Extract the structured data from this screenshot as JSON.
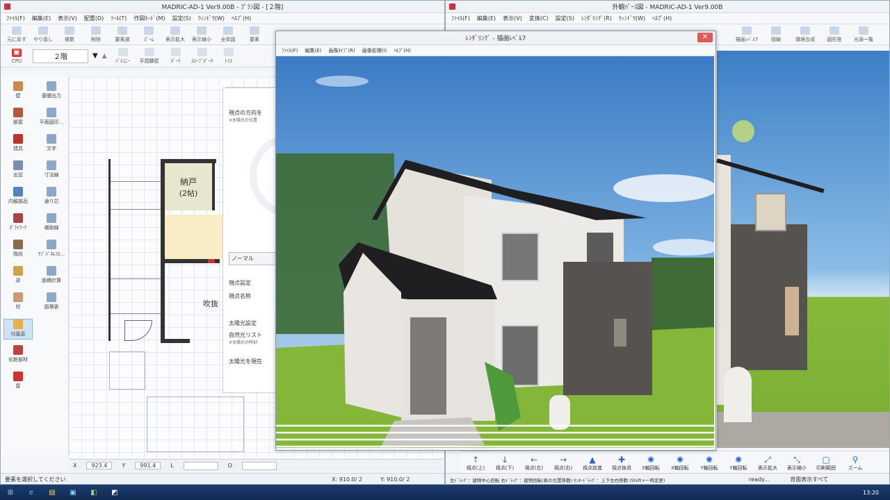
{
  "left_window": {
    "title": "MADRIC-AD-1 Ver9.00B - ﾌﾟﾗﾝ図 - [２階]",
    "menus": [
      "ﾌｧｲﾙ(F)",
      "編集(E)",
      "表示(V)",
      "配置(D)",
      "ﾂｰﾙ(T)",
      "作図ﾓｰﾄﾞ(M)",
      "設定(S)",
      "ｳｨﾝﾄﾞｳ(W)",
      "ﾍﾙﾌﾟ(H)"
    ],
    "toolbar": [
      {
        "label": "元に戻す",
        "icon": "undo-icon"
      },
      {
        "label": "やり直し",
        "icon": "redo-icon"
      },
      {
        "label": "複数",
        "icon": "copy-icon"
      },
      {
        "label": "削除",
        "icon": "delete-icon"
      },
      {
        "label": "要素選",
        "icon": "select-icon"
      },
      {
        "label": "ｽﾞｰﾑ",
        "icon": "zoom-icon"
      },
      {
        "label": "表示拡大",
        "icon": "zoom-in-icon"
      },
      {
        "label": "表示縮小",
        "icon": "zoom-out-icon"
      },
      {
        "label": "全体図",
        "icon": "fit-icon"
      },
      {
        "label": "要素",
        "icon": "pointer-icon"
      }
    ],
    "floor_label": "２階",
    "cpu_label": "CPU",
    "toolbar2": [
      "ﾊﾞﾙｺﾆｰ",
      "手摺腰壁",
      "ﾎﾟｰﾁ",
      "ｽﾛｰﾌﾟﾎﾟｰﾁ",
      "ﾄﾗｽ"
    ],
    "sidebar": [
      [
        "壁",
        "基礎出力"
      ],
      [
        "部屋",
        "平面図印..."
      ],
      [
        "建具",
        "文字"
      ],
      [
        "出窓",
        "寸法線"
      ],
      [
        "内観部品",
        "通り芯"
      ],
      [
        "ﾀﾞｸﾄﾜｰｸ",
        "補助線"
      ],
      [
        "階段",
        "ｻﾌﾞﾊﾟﾈﾙﾌﾛ..."
      ],
      [
        "梁",
        "面積計算"
      ],
      [
        "柱",
        "面積表"
      ],
      [
        "付属品",
        ""
      ],
      [
        "化粧部材",
        ""
      ],
      [
        "屋",
        ""
      ]
    ],
    "plan": {
      "room_name": "納戸",
      "room_size": "(2帖)",
      "void_label": "吹抜"
    },
    "dialog": {
      "view_dir_title": "視点の方向を",
      "view_dir_note": "※太陽光の位置",
      "normal_btn": "ノーマル",
      "viewpoint_title": "視点設定",
      "viewpoint_name": "視点名称",
      "sun_title": "太陽光設定",
      "natural_light": "自然光リスト",
      "sun_note": "※太陽光の時刻",
      "sun_apply": "太陽光を現在"
    },
    "coords": {
      "x": "X",
      "x_val": "923.4",
      "y": "Y",
      "y_val": "991.4",
      "l": "L",
      "o": "O"
    },
    "status": {
      "message": "要素を選択してください",
      "x": "X: 910.0/ 2",
      "y": "Y: 910.0/ 2"
    }
  },
  "right_window": {
    "title": "外観ﾊﾟｰｽ図 - MADRIC-AD-1 Ver9.00B",
    "menus": [
      "ﾌｧｲﾙ(F)",
      "編集(E)",
      "表示(V)",
      "変換(C)",
      "設定(S)",
      "ﾚﾝﾀﾞﾘﾝｸﾞ(R)",
      "ｳｨﾝﾄﾞｳ(W)",
      "ﾍﾙﾌﾟ(H)"
    ],
    "toolbar": [
      {
        "label": "描画ﾚﾍﾞﾙ7",
        "icon": "render-icon"
      },
      {
        "label": "隠線",
        "icon": "hidden-line-icon"
      },
      {
        "label": "環境合成",
        "icon": "composite-icon"
      },
      {
        "label": "図形登",
        "icon": "register-icon"
      },
      {
        "label": "光源一覧",
        "icon": "light-icon"
      }
    ],
    "nav_buttons": [
      {
        "label": "視点(上)",
        "icon": "arrow-up-icon",
        "glyph": "↑"
      },
      {
        "label": "視点(下)",
        "icon": "arrow-down-icon",
        "glyph": "↓"
      },
      {
        "label": "視点(左)",
        "icon": "arrow-left-icon",
        "glyph": "←"
      },
      {
        "label": "視点(右)",
        "icon": "arrow-right-icon",
        "glyph": "→"
      },
      {
        "label": "視点前進",
        "icon": "forward-icon",
        "glyph": "▲"
      },
      {
        "label": "視点後退",
        "icon": "backward-icon",
        "glyph": "✚"
      },
      {
        "label": "X軸回転",
        "icon": "rotate-x-icon",
        "glyph": "✺"
      },
      {
        "label": "X軸回転",
        "icon": "rotate-x2-icon",
        "glyph": "✺"
      },
      {
        "label": "Y軸回転",
        "icon": "rotate-y-icon",
        "glyph": "✺"
      },
      {
        "label": "Y軸回転",
        "icon": "rotate-y2-icon",
        "glyph": "✺"
      },
      {
        "label": "表示拡大",
        "icon": "zoom-in-icon",
        "glyph": "⤢"
      },
      {
        "label": "表示縮小",
        "icon": "zoom-out-icon",
        "glyph": "⤡"
      },
      {
        "label": "印刷範囲",
        "icon": "print-area-icon",
        "glyph": "▢"
      },
      {
        "label": "ズーム",
        "icon": "zoom-icon",
        "glyph": "⚲"
      }
    ],
    "hint": "左ﾄﾞﾗｯｸﾞ：建物中心回転 右ﾄﾞﾗｯｸﾞ：建物回転(真の位置移動) ｾﾝﾀｰﾄﾞﾗｯｸﾞ：上下左右移動 (Shift+一時変更)",
    "status_ready": "ready...",
    "status_right": "背面表示すべて"
  },
  "render_window": {
    "title": "ﾚﾝﾀﾞﾘﾝｸﾞ - 描画ﾚﾍﾞﾙ7",
    "menus": [
      "ﾌｧｲﾙ(F)",
      "編集(E)",
      "画像ﾀｲﾌﾟ(R)",
      "画像処理(I)",
      "ﾍﾙﾌﾟ(H)"
    ]
  },
  "taskbar": {
    "time": "13:20"
  },
  "colors": {
    "sky": "#3b7fc4",
    "grass": "#86b83a",
    "roof": "#1f1f22",
    "wall_light": "#e9e6e1",
    "wall_dark": "#55524f"
  }
}
